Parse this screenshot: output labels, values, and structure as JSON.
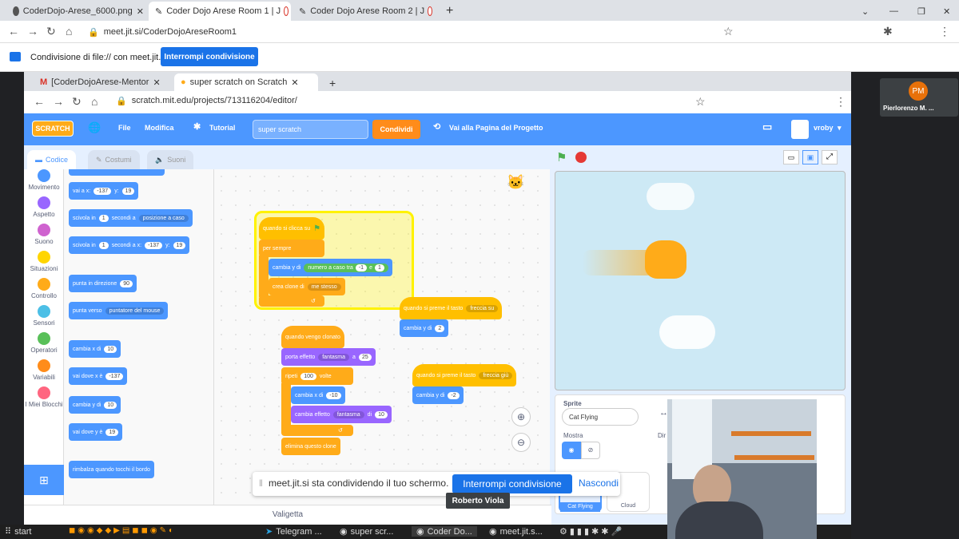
{
  "outer_tabs": [
    {
      "label": "CoderDojo-Arese_6000.png"
    },
    {
      "label": "Coder Dojo Arese Room 1 | J"
    },
    {
      "label": "Coder Dojo Arese Room 2 | J"
    }
  ],
  "outer_address": {
    "url": "meet.jit.si/CoderDojoAreseRoom1"
  },
  "share_bar": {
    "text": "Condivisione di file:// con meet.jit.si",
    "stop_label": "Interrompi condivisione"
  },
  "participant": {
    "initials": "PM",
    "name": "Pierlorenzo M. ..."
  },
  "inner_tabs": [
    {
      "label": "[CoderDojoArese-Mentor"
    },
    {
      "label": "super scratch on Scratch"
    }
  ],
  "inner_address": {
    "url": "scratch.mit.edu/projects/713116204/editor/"
  },
  "scratch_menu": {
    "logo": "SCRATCH",
    "file": "File",
    "edit": "Modifica",
    "tutorial": "Tutorial",
    "project_title": "super scratch",
    "share": "Condividi",
    "project_page": "Vai alla Pagina del Progetto",
    "user": "vroby"
  },
  "editor_tabs": {
    "code": "Codice",
    "costumes": "Costumi",
    "sounds": "Suoni"
  },
  "categories": [
    {
      "label": "Movimento",
      "color": "#4c97ff"
    },
    {
      "label": "Aspetto",
      "color": "#9966ff"
    },
    {
      "label": "Suono",
      "color": "#cf63cf"
    },
    {
      "label": "Situazioni",
      "color": "#ffd500"
    },
    {
      "label": "Controllo",
      "color": "#ffab19"
    },
    {
      "label": "Sensori",
      "color": "#4cbfe6"
    },
    {
      "label": "Operatori",
      "color": "#59c059"
    },
    {
      "label": "Variabili",
      "color": "#ff8c1a"
    },
    {
      "label": "I Miei Blocchi",
      "color": "#ff6680"
    }
  ],
  "palette": {
    "goto_xy": {
      "text": "vai a x:",
      "x": "-137",
      "y_label": "y:",
      "y": "19"
    },
    "glide_random": {
      "text": "scivola in",
      "secs": "1",
      "mid": "secondi a",
      "target": "posizione a caso"
    },
    "glide_xy": {
      "text": "scivola in",
      "secs": "1",
      "mid": "secondi a x:",
      "x": "-137",
      "y_label": "y:",
      "y": "19"
    },
    "point_dir": {
      "text": "punta in direzione",
      "val": "90"
    },
    "point_towards": {
      "text": "punta verso",
      "target": "puntatore del mouse"
    },
    "change_x": {
      "text": "cambia x di",
      "val": "10"
    },
    "set_x": {
      "text": "vai dove x è",
      "val": "-137"
    },
    "change_y": {
      "text": "cambia y di",
      "val": "10"
    },
    "set_y": {
      "text": "vai dove y è",
      "val": "19"
    },
    "bounce": {
      "text": "rimbalza quando tocchi il bordo"
    }
  },
  "scripts": {
    "flag_script": {
      "hat": "quando si clicca su",
      "forever": "per sempre",
      "change_y": "cambia y di",
      "random": "numero a caso tra",
      "r_from": "-1",
      "r_and": "e",
      "r_to": "1",
      "clone": "crea clone di",
      "clone_target": "me stesso"
    },
    "clone_script": {
      "hat": "quando vengo clonato",
      "effect": "porta effetto",
      "effect_name": "fantasma",
      "to": "a",
      "effect_val": "25",
      "repeat": "ripeti",
      "repeat_val": "100",
      "times": "volte",
      "change_x": "cambia x di",
      "change_x_val": "-10",
      "change_effect": "cambia effetto",
      "change_effect_name": "fantasma",
      "by": "di",
      "change_effect_val": "10",
      "delete": "elimina questo clone"
    },
    "up_script": {
      "hat": "quando si preme il tasto",
      "key": "freccia su",
      "change": "cambia y di",
      "val": "2"
    },
    "down_script": {
      "hat": "quando si preme il tasto",
      "key": "freccia giù",
      "change": "cambia y di",
      "val": "-2"
    }
  },
  "backpack": "Valigetta",
  "sprite_panel": {
    "label": "Sprite",
    "name": "Cat Flying",
    "show": "Mostra",
    "dir_abbr": "Dir",
    "sprite1": "Cat Flying",
    "sprite2": "Cloud"
  },
  "share_popup": {
    "text": "meet.jit.si sta condividendo il tuo schermo.",
    "stop": "Interrompi condivisione",
    "hide": "Nascondi"
  },
  "presenter": "Roberto Viola",
  "taskbar": {
    "start": "start",
    "telegram": "Telegram ...",
    "scratch": "super scr...",
    "coderdojo": "Coder Do...",
    "meet": "meet.jit.s..."
  }
}
